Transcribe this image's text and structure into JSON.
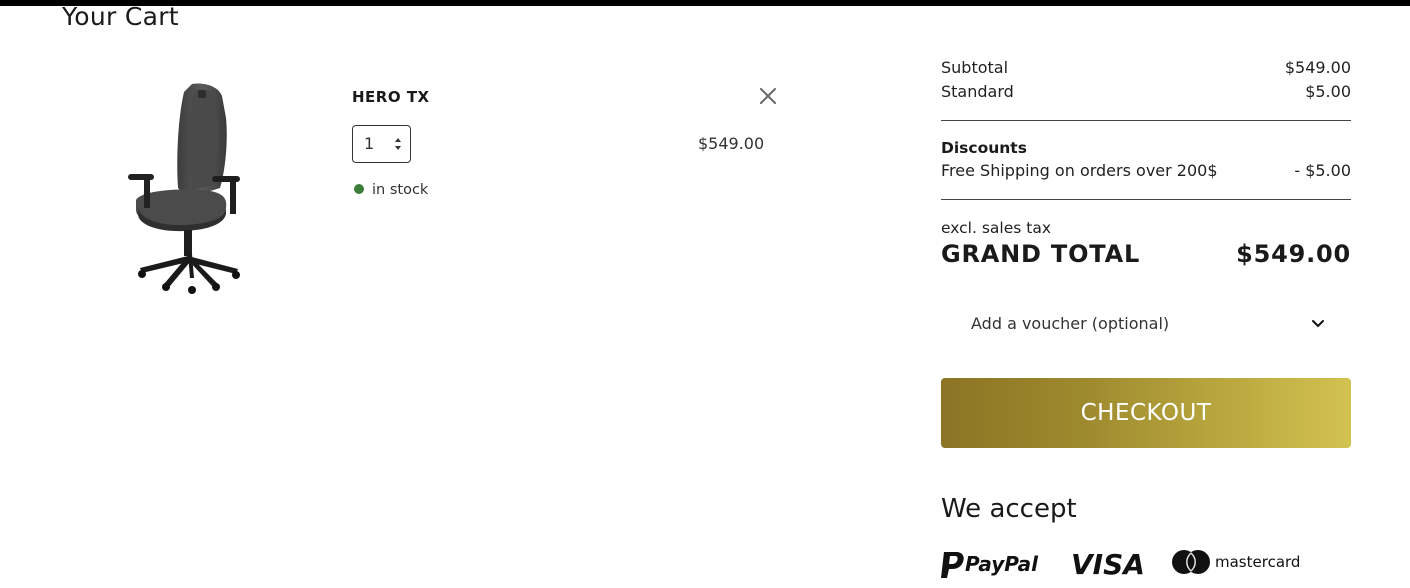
{
  "page": {
    "title": "Your Cart"
  },
  "cart": {
    "items": [
      {
        "name": "HERO TX",
        "quantity": "1",
        "price": "$549.00",
        "stock_status": "in stock"
      }
    ]
  },
  "summary": {
    "subtotal_label": "Subtotal",
    "subtotal_value": "$549.00",
    "shipping_label": "Standard",
    "shipping_value": "$5.00",
    "discounts_heading": "Discounts",
    "discount_label": "Free Shipping on orders over 200$",
    "discount_value": "- $5.00",
    "tax_note": "excl. sales tax",
    "grand_total_label": "GRAND TOTAL",
    "grand_total_value": "$549.00"
  },
  "voucher": {
    "label": "Add a voucher (optional)"
  },
  "checkout": {
    "label": "CHECKOUT"
  },
  "payments": {
    "title": "We accept",
    "methods": [
      "PayPal",
      "VISA",
      "mastercard"
    ]
  },
  "colors": {
    "stock_green": "#3c7d3a",
    "checkout_gradient_start": "#8b7424",
    "checkout_gradient_end": "#d2c250"
  },
  "icons": {
    "remove": "close-icon",
    "quantity": "updown-arrows-icon",
    "voucher": "chevron-down-icon"
  }
}
